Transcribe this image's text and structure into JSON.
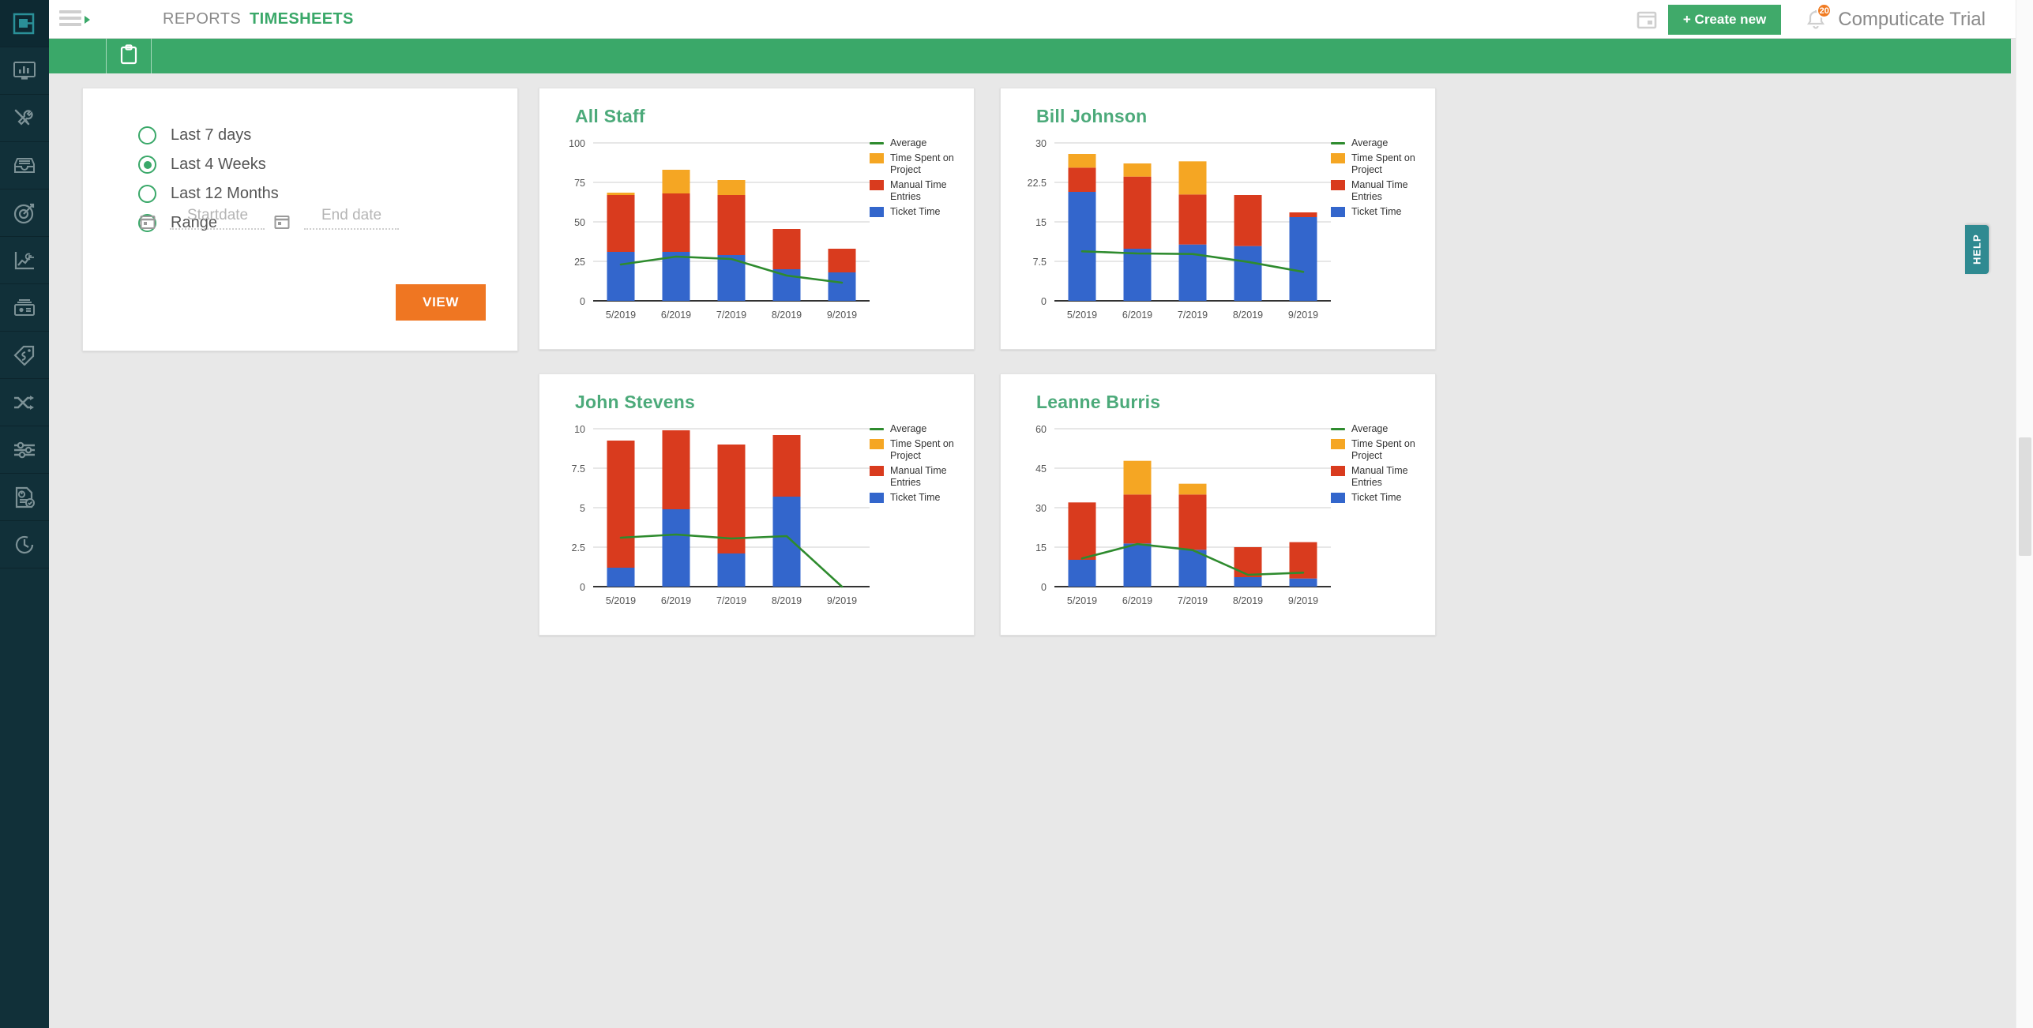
{
  "app": {
    "account_name": "Computicate Trial",
    "brand_green": "#3aa869",
    "accent_orange": "#ef7622",
    "rail_bg": "#113039",
    "help_teal": "#2f8a91"
  },
  "topnav": {
    "menu_icon": "hamburger-icon",
    "tabs": [
      {
        "label": "REPORTS",
        "active": false
      },
      {
        "label": "TIMESHEETS",
        "active": true
      }
    ],
    "calendar_icon": "calendar-icon",
    "create_new_label": "+ Create new",
    "bell_icon": "bell-icon",
    "notification_count": "20"
  },
  "subbar": {
    "clipboard_icon": "clipboard-icon"
  },
  "rail": {
    "items": [
      {
        "name": "logo",
        "icon": "app-logo-icon",
        "active": true
      },
      {
        "name": "dashboard",
        "icon": "monitor-chart-icon",
        "active": false
      },
      {
        "name": "tools",
        "icon": "tools-icon",
        "active": false
      },
      {
        "name": "inbox",
        "icon": "inbox-tray-icon",
        "active": false
      },
      {
        "name": "targets",
        "icon": "target-dart-icon",
        "active": false
      },
      {
        "name": "revenue",
        "icon": "euro-line-chart-icon",
        "active": false
      },
      {
        "name": "billing",
        "icon": "banknote-icon",
        "active": false
      },
      {
        "name": "products",
        "icon": "price-tag-icon",
        "active": false
      },
      {
        "name": "workflows",
        "icon": "shuffle-arrows-icon",
        "active": false
      },
      {
        "name": "settings",
        "icon": "sliders-icon",
        "active": false
      },
      {
        "name": "reports",
        "icon": "report-check-icon",
        "active": false
      },
      {
        "name": "timesheets",
        "icon": "clock-history-icon",
        "active": false
      }
    ]
  },
  "filter_panel": {
    "options": [
      {
        "label": "Last 7 days",
        "checked": false
      },
      {
        "label": "Last 4 Weeks",
        "checked": true
      },
      {
        "label": "Last 12 Months",
        "checked": false
      },
      {
        "label": "Range",
        "checked": false
      }
    ],
    "start_date": {
      "placeholder": "Startdate",
      "value": "",
      "icon": "calendar-icon"
    },
    "end_date": {
      "placeholder": "End date",
      "value": "",
      "icon": "calendar-icon"
    },
    "view_button_label": "VIEW"
  },
  "help_tab": {
    "label": "HELP"
  },
  "chart_style": {
    "colors": {
      "average": "#2e8b2e",
      "time_spent_on_project": "#f5a623",
      "manual_time_entries": "#d93b1e",
      "ticket_time": "#3366cc"
    },
    "legend_position": "right",
    "grid": true
  },
  "chart_data": [
    {
      "type": "bar",
      "stacked": true,
      "title": "All Staff",
      "xlabel": "",
      "ylabel": "",
      "categories": [
        "5/2019",
        "6/2019",
        "7/2019",
        "8/2019",
        "9/2019"
      ],
      "ylim": [
        0,
        100
      ],
      "yticks": [
        0,
        25,
        50,
        75,
        100
      ],
      "series": [
        {
          "name": "Ticket Time",
          "values": [
            31,
            31,
            29,
            20,
            18
          ]
        },
        {
          "name": "Manual Time Entries",
          "values": [
            36,
            37,
            38,
            25.5,
            15
          ]
        },
        {
          "name": "Time Spent on Project",
          "values": [
            1.5,
            15,
            9.5,
            0,
            0
          ]
        }
      ],
      "line_series": {
        "name": "Average",
        "values": [
          23,
          28,
          26.5,
          16,
          11.5
        ]
      },
      "legend": [
        "Average",
        "Time Spent on Project",
        "Manual Time Entries",
        "Ticket Time"
      ]
    },
    {
      "type": "bar",
      "stacked": true,
      "title": "Bill Johnson",
      "xlabel": "",
      "ylabel": "",
      "categories": [
        "5/2019",
        "6/2019",
        "7/2019",
        "8/2019",
        "9/2019"
      ],
      "ylim": [
        0,
        30
      ],
      "yticks": [
        0,
        7.5,
        15,
        22.5,
        30
      ],
      "series": [
        {
          "name": "Ticket Time",
          "values": [
            20.7,
            9.9,
            10.7,
            10.4,
            15.9
          ]
        },
        {
          "name": "Manual Time Entries",
          "values": [
            4.6,
            13.7,
            9.5,
            9.7,
            0.9
          ]
        },
        {
          "name": "Time Spent on Project",
          "values": [
            2.6,
            2.5,
            6.3,
            0,
            0
          ]
        }
      ],
      "line_series": {
        "name": "Average",
        "values": [
          9.4,
          9.0,
          8.9,
          7.4,
          5.5
        ]
      },
      "legend": [
        "Average",
        "Time Spent on Project",
        "Manual Time Entries",
        "Ticket Time"
      ]
    },
    {
      "type": "bar",
      "stacked": true,
      "title": "John Stevens",
      "xlabel": "",
      "ylabel": "",
      "categories": [
        "5/2019",
        "6/2019",
        "7/2019",
        "8/2019",
        "9/2019"
      ],
      "ylim": [
        0,
        10
      ],
      "yticks": [
        0,
        2.5,
        5,
        7.5,
        10
      ],
      "series": [
        {
          "name": "Ticket Time",
          "values": [
            1.2,
            4.9,
            2.1,
            5.7,
            0
          ]
        },
        {
          "name": "Manual Time Entries",
          "values": [
            8.05,
            5.0,
            6.9,
            3.9,
            0
          ]
        },
        {
          "name": "Time Spent on Project",
          "values": [
            0,
            0,
            0,
            0,
            0
          ]
        }
      ],
      "line_series": {
        "name": "Average",
        "values": [
          3.1,
          3.3,
          3.05,
          3.2,
          0
        ]
      },
      "legend": [
        "Average",
        "Time Spent on Project",
        "Manual Time Entries",
        "Ticket Time"
      ]
    },
    {
      "type": "bar",
      "stacked": true,
      "title": "Leanne Burris",
      "xlabel": "",
      "ylabel": "",
      "categories": [
        "5/2019",
        "6/2019",
        "7/2019",
        "8/2019",
        "9/2019"
      ],
      "ylim": [
        0,
        60
      ],
      "yticks": [
        0,
        15,
        30,
        45,
        60
      ],
      "series": [
        {
          "name": "Ticket Time",
          "values": [
            10.2,
            16.4,
            14.0,
            3.6,
            3.1
          ]
        },
        {
          "name": "Manual Time Entries",
          "values": [
            21.8,
            18.6,
            21.0,
            11.4,
            13.8
          ]
        },
        {
          "name": "Time Spent on Project",
          "values": [
            0,
            12.8,
            4.1,
            0,
            0
          ]
        }
      ],
      "line_series": {
        "name": "Average",
        "values": [
          10.7,
          16.2,
          13.9,
          4.5,
          5.3
        ]
      },
      "legend": [
        "Average",
        "Time Spent on Project",
        "Manual Time Entries",
        "Ticket Time"
      ]
    }
  ]
}
